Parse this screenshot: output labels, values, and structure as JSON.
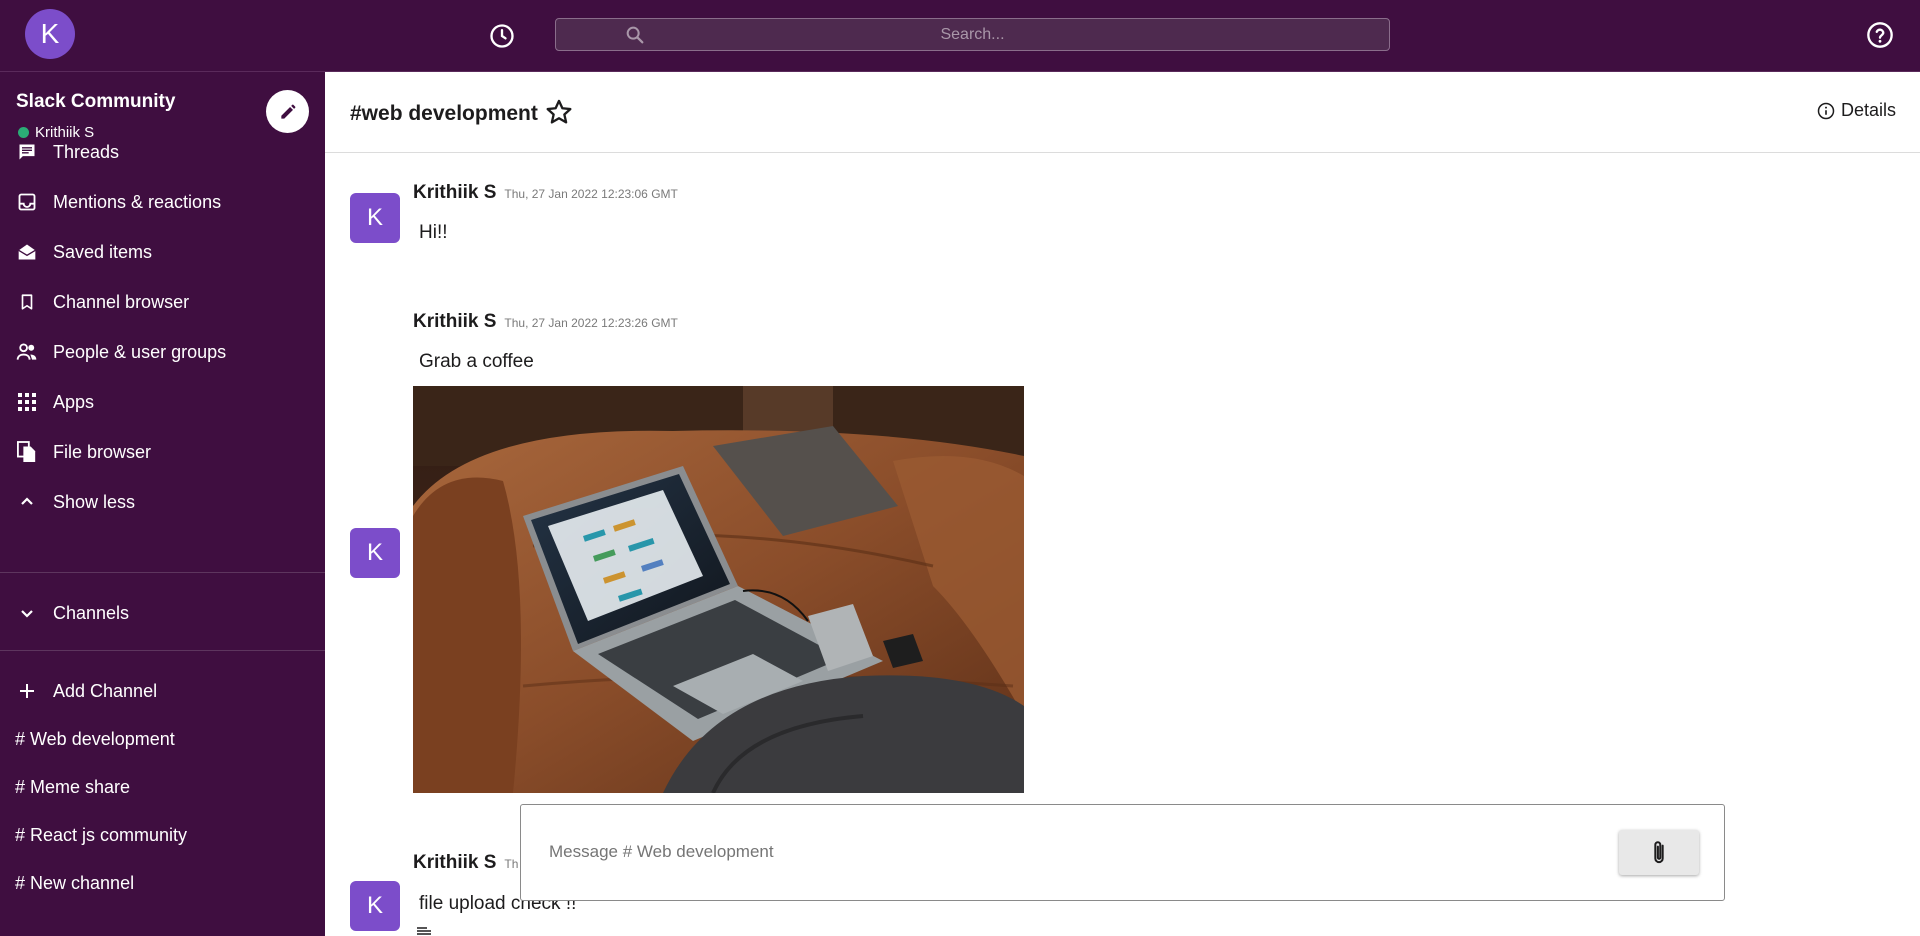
{
  "topbar": {
    "avatar_letter": "K",
    "search_placeholder": "Search..."
  },
  "sidebar": {
    "workspace_name": "Slack Community",
    "user_name": "Krithiik S",
    "nav": [
      {
        "label": "Threads",
        "icon": "threads-icon"
      },
      {
        "label": "Mentions & reactions",
        "icon": "inbox-icon"
      },
      {
        "label": "Saved items",
        "icon": "drafts-icon"
      },
      {
        "label": "Channel browser",
        "icon": "bookmark-icon"
      },
      {
        "label": "People & user groups",
        "icon": "people-icon"
      },
      {
        "label": "Apps",
        "icon": "apps-grid-icon"
      },
      {
        "label": "File browser",
        "icon": "file-copy-icon"
      },
      {
        "label": "Show less",
        "icon": "chevron-up-icon"
      }
    ],
    "channels_label": "Channels",
    "add_channel_label": "Add Channel",
    "channels": [
      "# Web development",
      "# Meme share",
      "# React js community",
      "# New channel"
    ]
  },
  "channel": {
    "title": "#web development",
    "details_label": "Details"
  },
  "messages": [
    {
      "avatar": "K",
      "author": "Krithiik S",
      "time": "Thu, 27 Jan 2022 12:23:06 GMT",
      "text": "Hi!!"
    },
    {
      "avatar": "K",
      "author": "Krithiik S",
      "time": "Thu, 27 Jan 2022 12:23:26 GMT",
      "text": "Grab a coffee"
    },
    {
      "avatar": "K",
      "author": "Krithiik S",
      "time": "Th",
      "text": "file upload check !!"
    }
  ],
  "composer": {
    "placeholder": "Message # Web development"
  },
  "colors": {
    "aubergine": "#3f0e40",
    "avatar_purple": "#7c4dca",
    "online_green": "#2bac76"
  }
}
